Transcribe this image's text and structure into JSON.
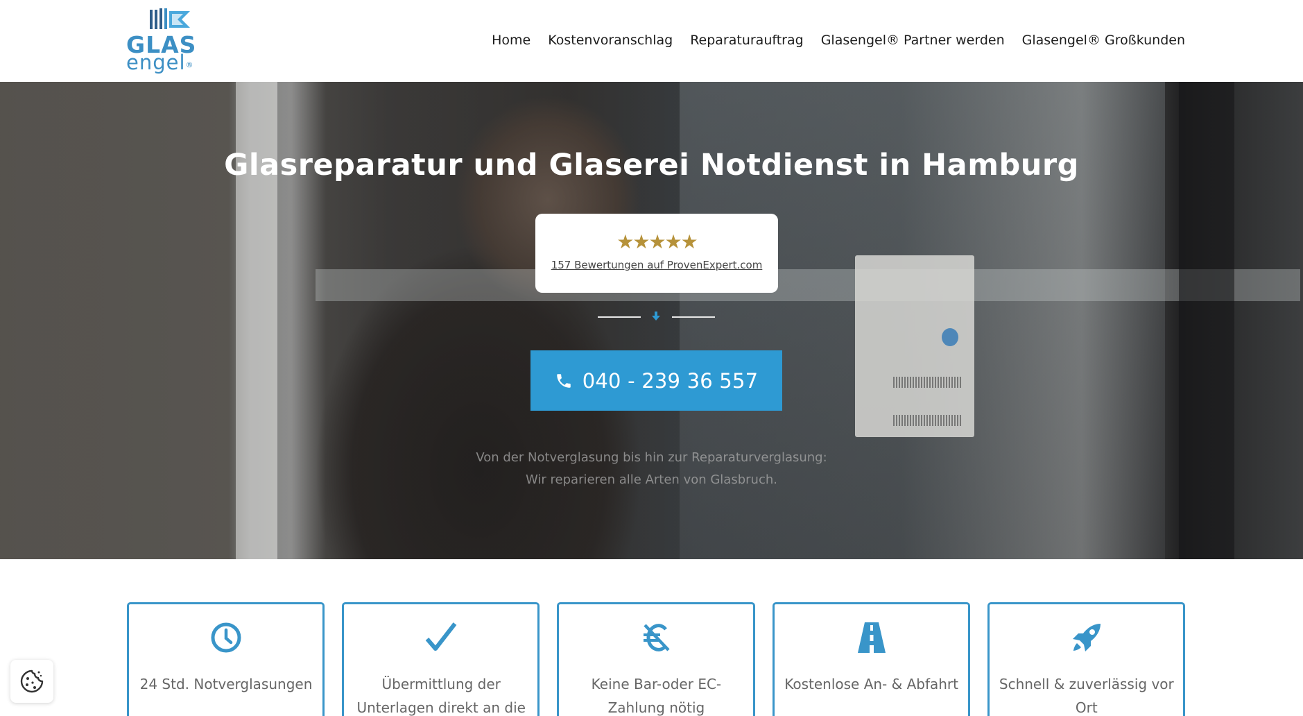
{
  "header": {
    "logo": {
      "word1": "GLAS",
      "word2": "engel",
      "reg": "®",
      "color": "#3c8fc4"
    },
    "nav": [
      {
        "label": "Home"
      },
      {
        "label": "Kostenvoranschlag"
      },
      {
        "label": "Reparaturauftrag"
      },
      {
        "label": "Glasengel® Partner werden"
      },
      {
        "label": "Glasengel® Großkunden"
      }
    ]
  },
  "hero": {
    "title": "Glasreparatur und Glaserei Notdienst in Hamburg",
    "rating": {
      "stars": "★★★★★",
      "star_color": "#b6923a",
      "link_text": "157 Bewertungen auf ProvenExpert.com"
    },
    "divider_icon": "arrow-down-icon",
    "phone_button": {
      "label": "040 - 239 36 557",
      "icon": "phone-icon",
      "color": "#2e9ad3"
    },
    "subtitle_line1": "Von der Notverglasung bis hin zur Reparaturverglasung:",
    "subtitle_line2": "Wir reparieren alle Arten von Glasbruch."
  },
  "features": [
    {
      "icon": "clock-icon",
      "text": "24 Std. Notverglasungen"
    },
    {
      "icon": "checkmark-icon",
      "text": "Übermittlung der Unterlagen direkt an die"
    },
    {
      "icon": "no-euro-icon",
      "text": "Keine Bar-oder EC-Zahlung nötig"
    },
    {
      "icon": "road-icon",
      "text": "Kostenlose An- & Abfahrt"
    },
    {
      "icon": "rocket-icon",
      "text": "Schnell & zuverlässig vor Ort"
    }
  ],
  "accent_color": "#3995c9",
  "cookie_button": {
    "icon": "cookie-icon"
  }
}
